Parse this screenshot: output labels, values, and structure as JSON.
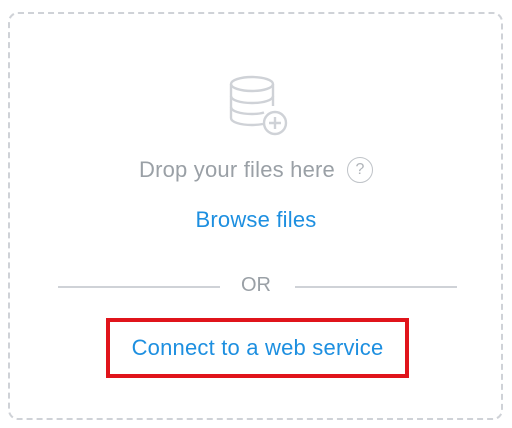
{
  "dropzone": {
    "icon": "database-add-icon",
    "drop_text": "Drop your files here",
    "help_icon": "question-mark-icon",
    "help_glyph": "?",
    "browse_label": "Browse files",
    "separator_label": "OR",
    "connect_label": "Connect to a web service"
  },
  "colors": {
    "link": "#1d8fe0",
    "muted_text": "#9aa0a6",
    "border": "#cfd2d7",
    "highlight": "#e0141b"
  }
}
